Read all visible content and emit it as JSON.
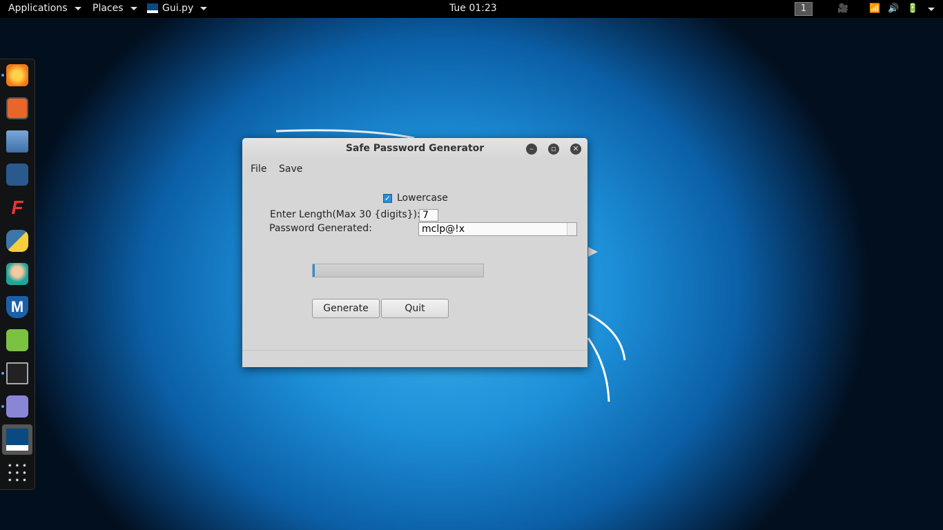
{
  "topbar": {
    "applications": "Applications",
    "places": "Places",
    "active_app": "Gui.py",
    "clock": "Tue 01:23",
    "workspace": "1"
  },
  "dock": {
    "items": [
      "firefox",
      "burpsuite",
      "files",
      "armitage",
      "faraday",
      "python",
      "maltego",
      "metasploit",
      "leafpad",
      "terminal",
      "text-editor",
      "gui-py",
      "show-apps"
    ]
  },
  "window": {
    "title": "Safe Password Generator",
    "menu": {
      "file": "File",
      "save": "Save"
    },
    "checkbox": {
      "label": "Lowercase",
      "checked": true
    },
    "length_label": "Enter Length(Max 30 {digits}):",
    "length_value": "7",
    "password_label": "Password Generated:",
    "password_value": "mclp@!x",
    "progress": 0.01,
    "buttons": {
      "generate": "Generate",
      "quit": "Quit"
    }
  },
  "colors": {
    "accent": "#2a8fd6"
  }
}
